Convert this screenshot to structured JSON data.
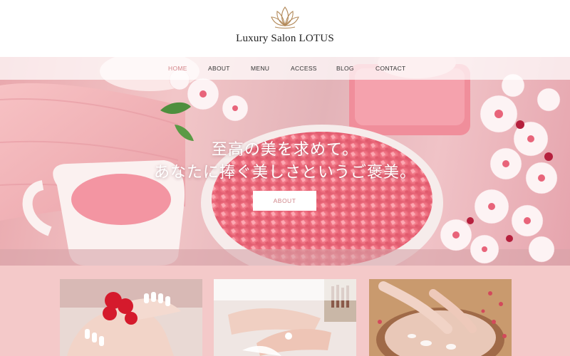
{
  "site": {
    "title": "Luxury Salon LOTUS",
    "logo_icon": "lotus-flower-icon",
    "accent_color": "#d4868a",
    "background_color": "#f4c9c9"
  },
  "nav": {
    "items": [
      {
        "label": "HOME",
        "active": true
      },
      {
        "label": "ABOUT",
        "active": false
      },
      {
        "label": "MENU",
        "active": false
      },
      {
        "label": "ACCESS",
        "active": false
      },
      {
        "label": "BLOG",
        "active": false
      },
      {
        "label": "CONTACT",
        "active": false
      }
    ]
  },
  "hero": {
    "line1": "至高の美を求めて。",
    "line2": "あなたに捧ぐ美しさというご褒美。",
    "button_label": "ABOUT"
  },
  "gallery": {
    "images": [
      "hands-with-rose-petals-image",
      "manicure-treatment-image",
      "hand-spa-bowl-image"
    ]
  }
}
